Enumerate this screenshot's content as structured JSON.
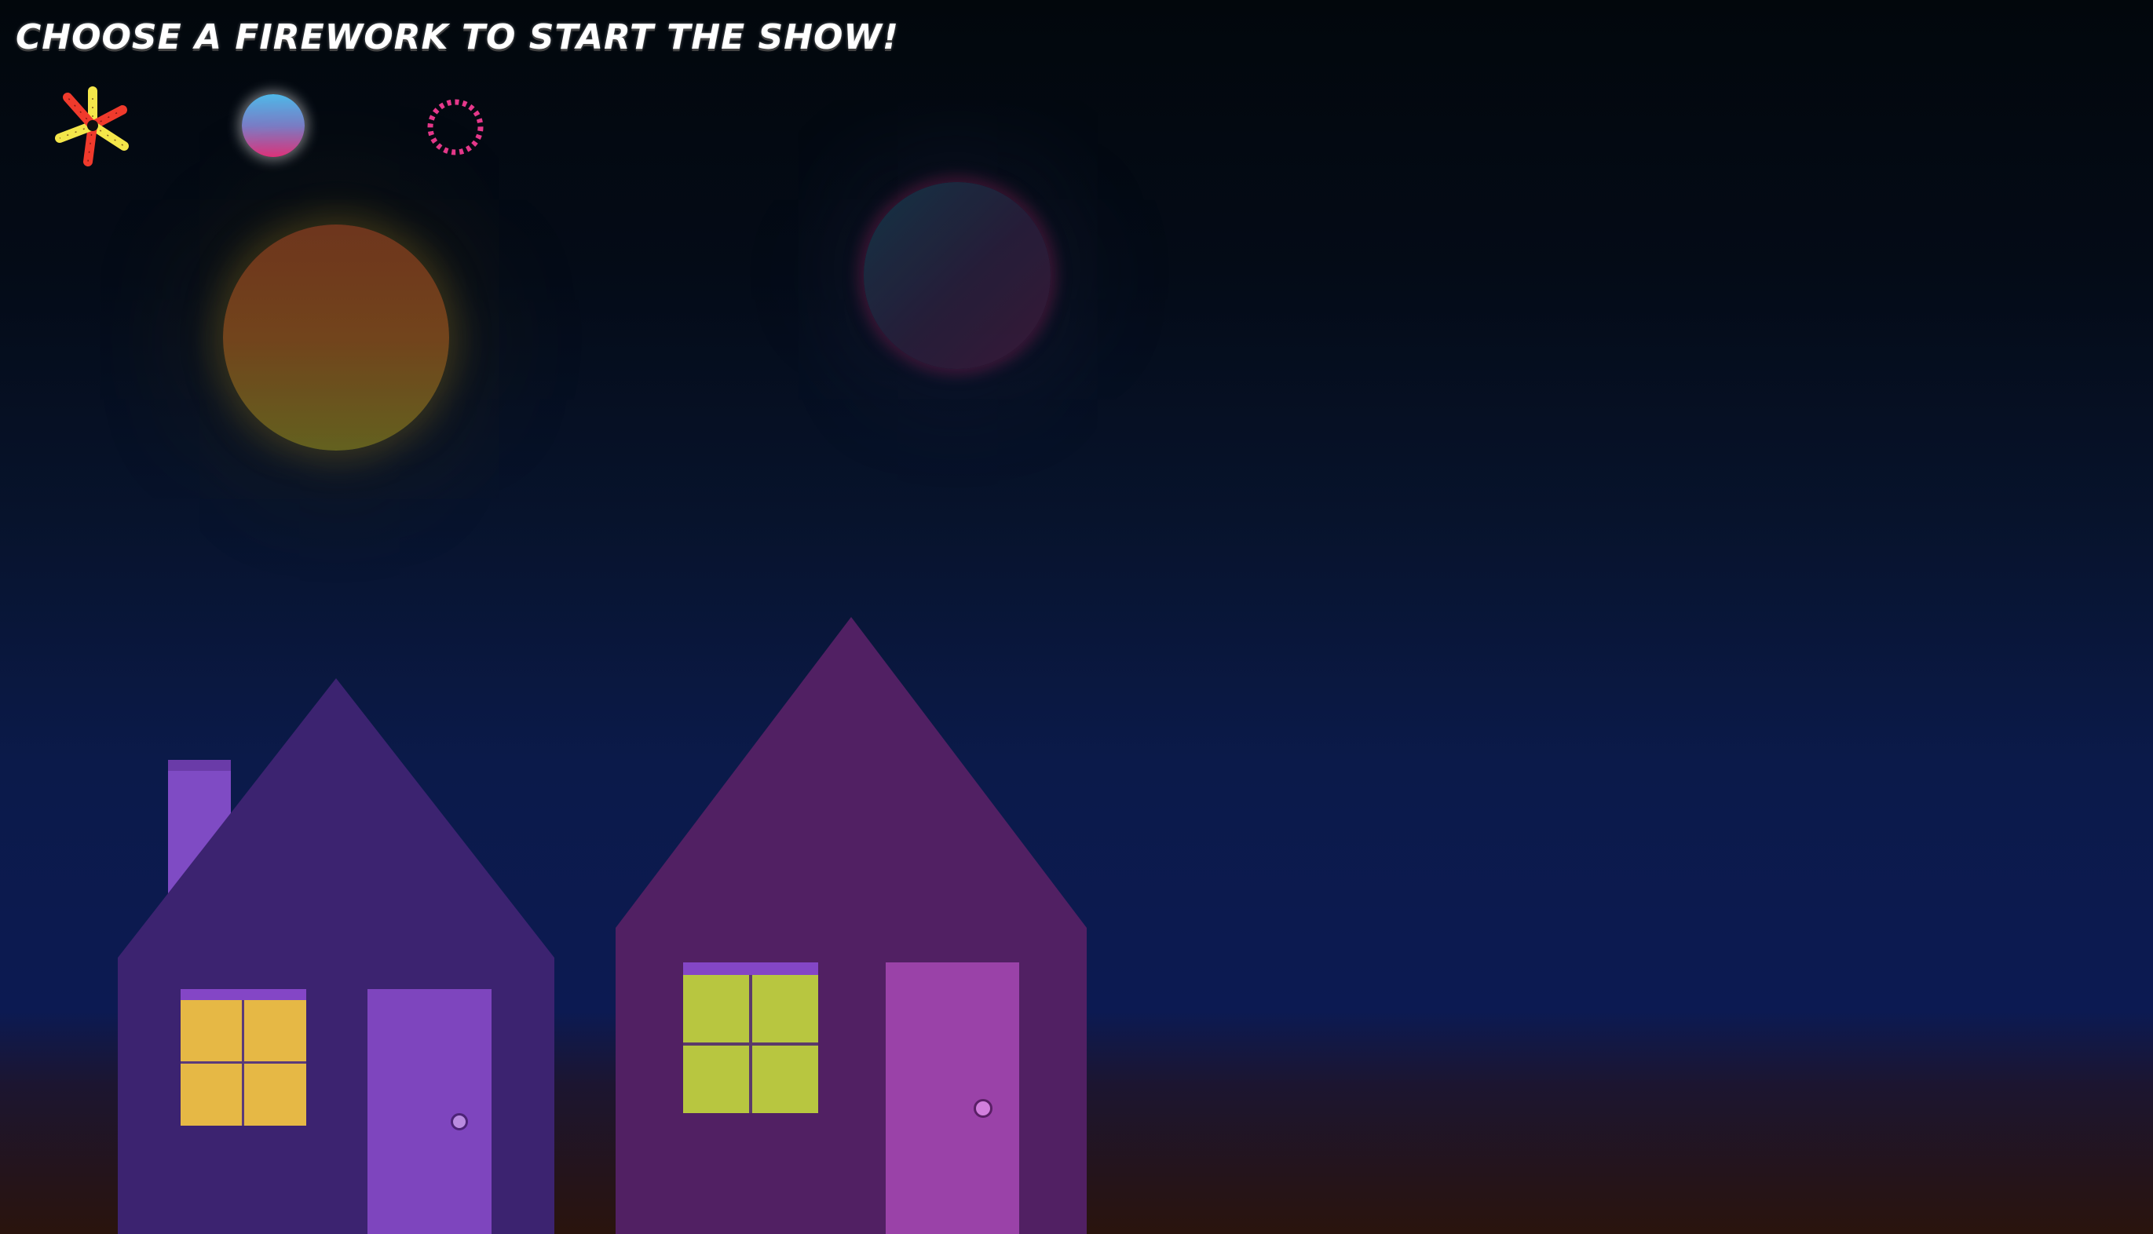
{
  "title": "Choose a firework to start the show!",
  "fireworks": [
    {
      "name": "starburst",
      "icon": "starburst-icon",
      "colors": [
        "#f03a2c",
        "#f4e64a"
      ]
    },
    {
      "name": "orb",
      "icon": "gradient-orb-icon",
      "colors": [
        "#4fb8e8",
        "#e3337f"
      ]
    },
    {
      "name": "ring",
      "icon": "dotted-ring-icon",
      "colors": [
        "#e6388b"
      ]
    }
  ],
  "colors": {
    "house1_body": "#3c2370",
    "house1_chimney": "#7f4bc4",
    "house1_window": "#e6b845",
    "house1_door": "#7e45be",
    "house2_body": "#512063",
    "house2_window": "#b8c640",
    "house2_door": "#9a42a8",
    "window_trim": "#8446c6"
  }
}
